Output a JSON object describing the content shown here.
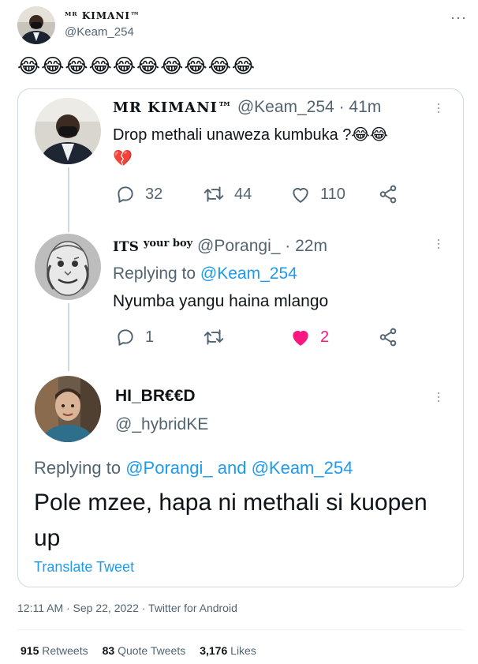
{
  "author": {
    "name": "ᴹᴿ KIMANI™",
    "handle": "@Keam_254",
    "more": "···"
  },
  "tweet_text": "😂😂😂😂😂😂😂😂😂😂",
  "quoted_thread": {
    "tweet1": {
      "name": "MR KIMANI™",
      "handle": "@Keam_254",
      "time": "· 41m",
      "text": "Drop methali unaweza kumbuka ?😂😂",
      "emoji": "💔",
      "replies": "32",
      "retweets": "44",
      "likes": "110"
    },
    "tweet2": {
      "name_main": "ITS",
      "name_super": "your boy",
      "handle": "@Porangi_",
      "time": "· 22m",
      "replying_prefix": "Replying to",
      "replying_to": "@Keam_254",
      "text": "Nyumba yangu haina mlango",
      "replies": "1",
      "retweets": "",
      "likes": "2"
    },
    "tweet3": {
      "name": "HI_BR€€D",
      "handle": "@_hybridKE",
      "replying_prefix": "Replying to",
      "replying_to_1": "@Porangi_",
      "replying_and": "and",
      "replying_to_2": "@Keam_254",
      "text": "Pole mzee, hapa ni methali si kuopen up",
      "translate": "Translate Tweet"
    }
  },
  "meta": "12:11 AM · Sep 22, 2022 · Twitter for Android",
  "stats": {
    "retweets_count": "915",
    "retweets_label": "Retweets",
    "quotes_count": "83",
    "quotes_label": "Quote Tweets",
    "likes_count": "3,176",
    "likes_label": "Likes"
  },
  "colors": {
    "accent": "#1d9bf0",
    "like": "#f91880",
    "secondary": "#536471"
  }
}
